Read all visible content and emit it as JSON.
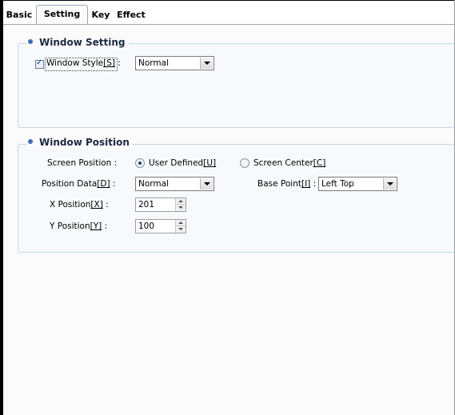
{
  "tabs": [
    {
      "label": "Basic",
      "active": false
    },
    {
      "label": "Setting",
      "active": true
    },
    {
      "label": "Key",
      "active": false
    },
    {
      "label": "Effect",
      "active": false
    }
  ],
  "window_setting": {
    "title": "Window Setting",
    "style_checkbox": {
      "checked": true,
      "label_prefix": "Window Style",
      "label_key": "[S]",
      "label_suffix": " :"
    },
    "style_select": {
      "value": "Normal"
    }
  },
  "window_position": {
    "title": "Window Position",
    "screen_position": {
      "label": "Screen Position :",
      "user_defined": {
        "prefix": "User Defined",
        "key": "[U]",
        "selected": true
      },
      "screen_center": {
        "prefix": "Screen Center",
        "key": "[C]",
        "selected": false
      }
    },
    "position_data": {
      "prefix": "Position Data",
      "key": "[D]",
      "suffix": " :",
      "value": "Normal"
    },
    "base_point": {
      "prefix": "Base Point",
      "key": "[I]",
      "suffix": " :",
      "value": "Left Top"
    },
    "x_position": {
      "prefix": "X Position",
      "key": "[X]",
      "suffix": " :",
      "value": "201"
    },
    "y_position": {
      "prefix": "Y Position",
      "key": "[Y]",
      "suffix": " :",
      "value": "100"
    }
  },
  "colors": {
    "accent": "#3b6fb6",
    "group_border": "#c9d4e3",
    "tab_border": "#9aa7b8"
  }
}
